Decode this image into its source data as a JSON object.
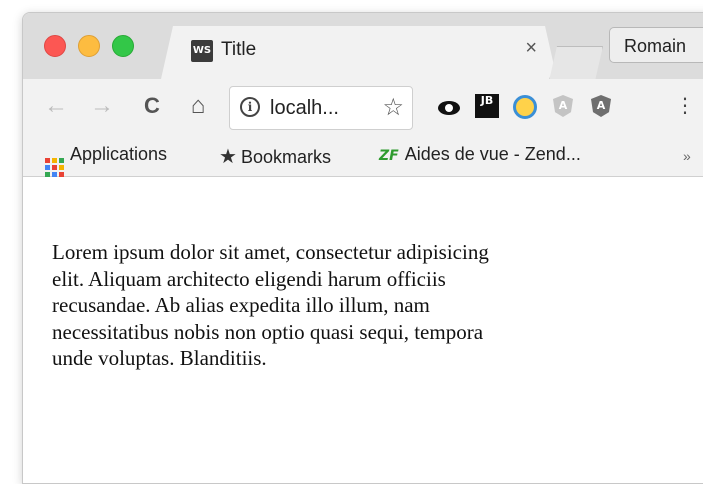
{
  "window": {
    "tab": {
      "favicon_text": "WS",
      "title": "Title",
      "close_symbol": "×"
    },
    "profile_name": "Romain"
  },
  "toolbar": {
    "back_symbol": "←",
    "forward_symbol": "→",
    "reload_symbol": "C",
    "home_symbol": "⌂",
    "url": "localh...",
    "info_symbol": "i",
    "star_symbol": "☆",
    "extensions": {
      "jb_text": "JB",
      "angular_text": "A"
    },
    "menu_symbol": "⋮"
  },
  "bookmarks": {
    "apps_label": "Applications",
    "bookmarks_label": "Bookmarks",
    "zend_icon_text": "ZF",
    "zend_label": "Aides de vue - Zend...",
    "more_symbol": "»"
  },
  "page": {
    "paragraph": "Lorem ipsum dolor sit amet, consectetur adipisicing elit. Aliquam architecto eligendi harum officiis recusandae. Ab alias expedita illo illum, nam necessitatibus nobis non optio quasi sequi, tempora unde voluptas. Blanditiis."
  },
  "colors": {
    "traffic_red": "#fc5753",
    "traffic_yellow": "#fdbc40",
    "traffic_green": "#33c748",
    "zend_green": "#2e9b2e"
  }
}
